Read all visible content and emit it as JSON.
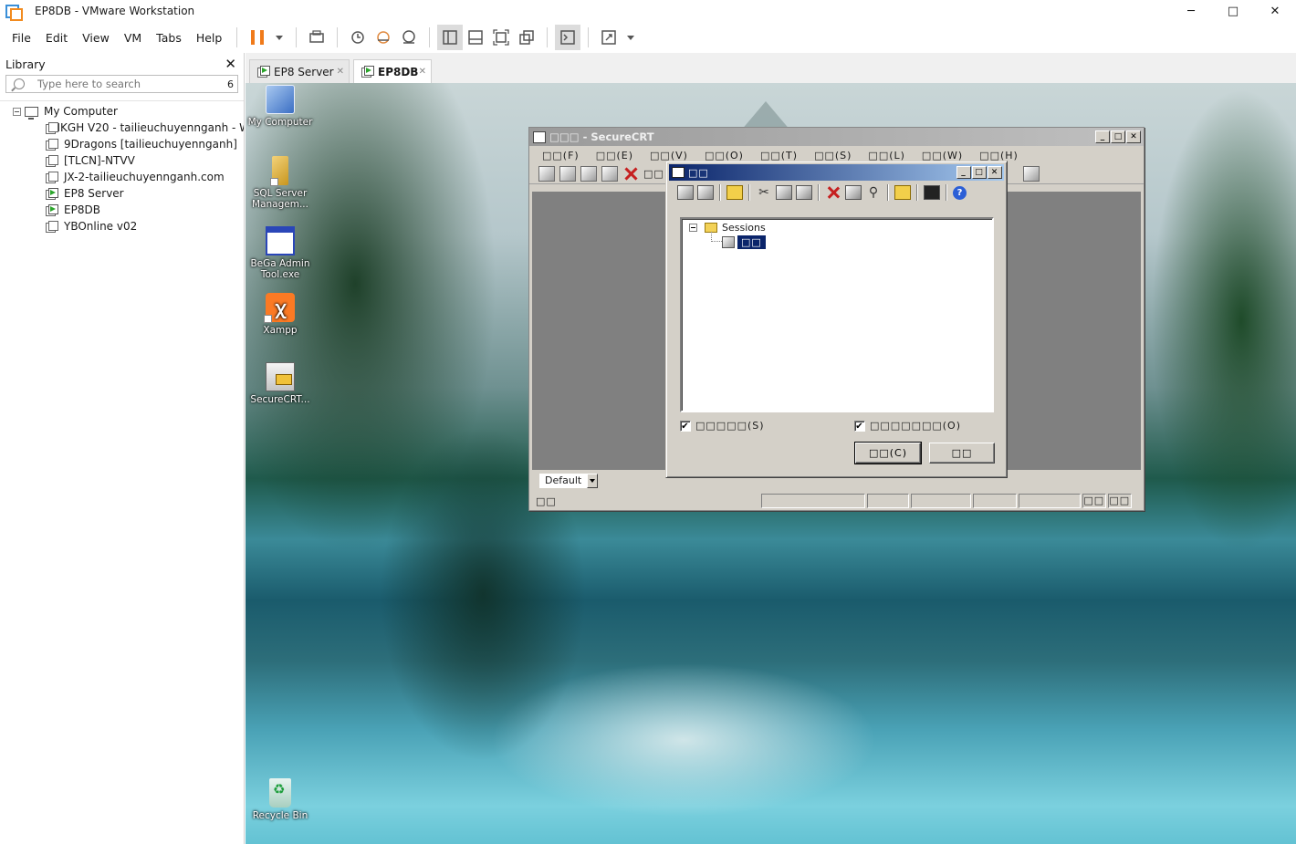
{
  "window": {
    "title": "EP8DB - VMware Workstation",
    "controls": {
      "minimize": "─",
      "maximize": "□",
      "close": "✕"
    }
  },
  "menu": {
    "items": [
      "File",
      "Edit",
      "View",
      "VM",
      "Tabs",
      "Help"
    ]
  },
  "library": {
    "title": "Library",
    "close": "✕",
    "search_placeholder": "Type here to search",
    "search_count": "6",
    "root": "My Computer",
    "vms": [
      {
        "name": "HKGH V20 - tailieuchuyennganh - W",
        "running": false
      },
      {
        "name": "9Dragons  [tailieuchuyennganh]",
        "running": false
      },
      {
        "name": "[TLCN]-NTVV",
        "running": false
      },
      {
        "name": "JX-2-tailieuchuyennganh.com",
        "running": false
      },
      {
        "name": "EP8 Server",
        "running": true
      },
      {
        "name": "EP8DB",
        "running": true
      },
      {
        "name": "YBOnline v02",
        "running": false
      }
    ]
  },
  "tabs": [
    {
      "label": "EP8 Server",
      "active": false
    },
    {
      "label": "EP8DB",
      "active": true
    }
  ],
  "desktop_icons": [
    {
      "label": "My Computer",
      "icon": "my-computer-icon"
    },
    {
      "label": "SQL Server Managem...",
      "icon": "sql-server-icon"
    },
    {
      "label": "BeGa Admin Tool.exe",
      "icon": "bega-admin-icon"
    },
    {
      "label": "Xampp",
      "icon": "xampp-icon"
    },
    {
      "label": "SecureCRT...",
      "icon": "securecrt-icon"
    },
    {
      "label": "Recycle Bin",
      "icon": "recycle-bin-icon"
    }
  ],
  "securecrt": {
    "title": "□□□ - SecureCRT",
    "menu": [
      "□□(F)",
      "□□(E)",
      "□□(V)",
      "□□(O)",
      "□□(T)",
      "□□(S)",
      "□□(L)",
      "□□(W)",
      "□□(H)"
    ],
    "toolbar_text": "□□",
    "session_tab_select": "Default",
    "status_left": "□□",
    "status_cells": [
      "",
      "",
      "",
      "",
      "",
      "□□",
      "□□"
    ]
  },
  "session_dialog": {
    "title": "□□",
    "tree_root": "Sessions",
    "selected_session": "□□",
    "checkbox_left": {
      "label": "□□□□□(S)",
      "checked": true,
      "mark": "✔"
    },
    "checkbox_right": {
      "label": "□□□□□□□(O)",
      "checked": true,
      "mark": "✔"
    },
    "connect_button": "□□(C)",
    "close_button": "□□",
    "help_glyph": "?"
  }
}
